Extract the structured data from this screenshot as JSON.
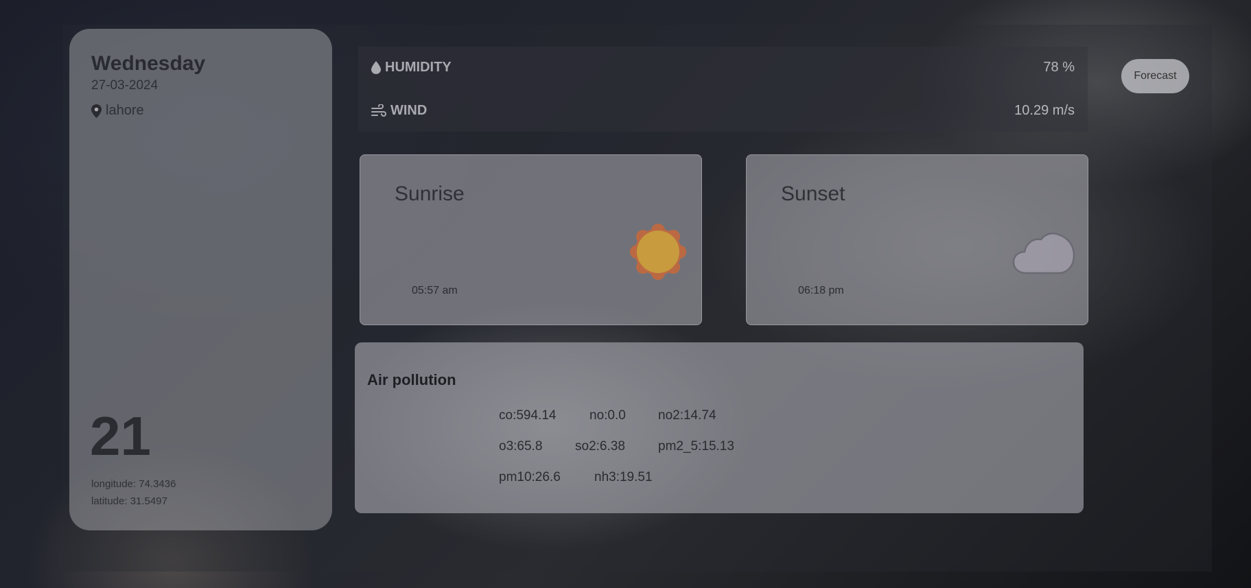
{
  "location_card": {
    "day": "Wednesday",
    "date": "27-03-2024",
    "city": "lahore",
    "temperature": "21",
    "longitude": "longitude: 74.3436",
    "latitude": "latitude: 31.5497"
  },
  "stats": {
    "humidity_label": "HUMIDITY",
    "humidity_value": "78 %",
    "wind_label": "WIND",
    "wind_value": "10.29 m/s"
  },
  "forecast_button": "Forecast",
  "sunrise": {
    "title": "Sunrise",
    "time": "05:57 am",
    "icon": "sun-icon"
  },
  "sunset": {
    "title": "Sunset",
    "time": "06:18 pm",
    "icon": "cloud-icon"
  },
  "air_pollution": {
    "title": "Air pollution",
    "items": [
      "co:594.14",
      "no:0.0",
      "no2:14.74",
      "o3:65.8",
      "so2:6.38",
      "pm2_5:15.13",
      "pm10:26.6",
      "nh3:19.51"
    ]
  },
  "colors": {
    "sun_fill": "#c9a13e",
    "sun_rays": "#c8683a"
  }
}
